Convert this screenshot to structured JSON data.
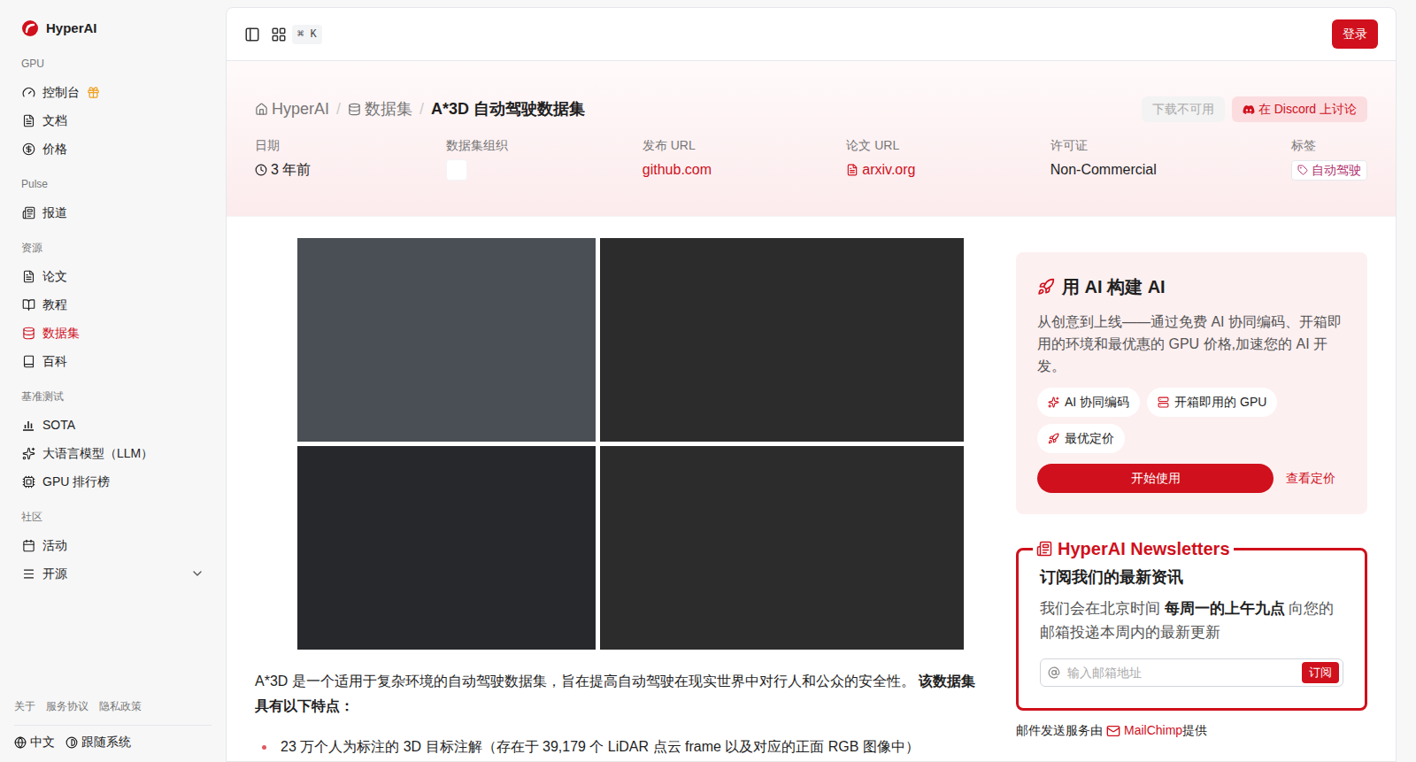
{
  "brand": "HyperAI",
  "sidebar": {
    "sections": [
      {
        "title": "GPU",
        "items": [
          {
            "label": "控制台",
            "selected": false,
            "kind": "link"
          },
          {
            "label": "文档",
            "selected": false,
            "kind": "link"
          },
          {
            "label": "价格",
            "selected": false,
            "kind": "link"
          }
        ]
      },
      {
        "title": "Pulse",
        "items": [
          {
            "label": "报道",
            "selected": false,
            "kind": "link"
          }
        ]
      },
      {
        "title": "资源",
        "items": [
          {
            "label": "论文",
            "selected": false,
            "kind": "link"
          },
          {
            "label": "教程",
            "selected": false,
            "kind": "link"
          },
          {
            "label": "数据集",
            "selected": true,
            "kind": "link"
          },
          {
            "label": "百科",
            "selected": false,
            "kind": "link"
          }
        ]
      },
      {
        "title": "基准测试",
        "items": [
          {
            "label": "SOTA",
            "selected": false,
            "kind": "link"
          },
          {
            "label": "大语言模型（LLM）",
            "selected": false,
            "kind": "link"
          },
          {
            "label": "GPU 排行榜",
            "selected": false,
            "kind": "link"
          }
        ]
      },
      {
        "title": "社区",
        "items": [
          {
            "label": "活动",
            "selected": false,
            "kind": "link"
          },
          {
            "label": "开源",
            "selected": false,
            "kind": "group",
            "expanded": false
          }
        ]
      }
    ],
    "footer_links": [
      "关于",
      "服务协议",
      "隐私政策"
    ],
    "language": "中文",
    "theme": "跟随系统"
  },
  "header": {
    "shortcut": "⌘ K",
    "login": "登录"
  },
  "breadcrumb": {
    "items": [
      "HyperAI",
      "数据集"
    ],
    "current": "A*3D 自动驾驶数据集",
    "separator": "/"
  },
  "actions": [
    {
      "label": "下载不可用",
      "disabled": true
    },
    {
      "label": "在 Discord 上讨论",
      "disabled": false
    }
  ],
  "meta": {
    "date": {
      "label": "日期",
      "value": "3 年前"
    },
    "org": {
      "label": "数据集组织"
    },
    "release": {
      "label": "发布 URL",
      "value": "github.com"
    },
    "paper": {
      "label": "论文 URL",
      "value": "arxiv.org"
    },
    "license": {
      "label": "许可证",
      "value": "Non-Commercial"
    },
    "tags": {
      "label": "标签",
      "value": "自动驾驶"
    }
  },
  "body": {
    "intro": "A*3D 是一个适用于复杂环境的自动驾驶数据集，旨在提高自动驾驶在现实世界中对行人和公众的安全性。 ",
    "intro_bold": "该数据集具有以下特点：",
    "bullets": [
      "23 万个人为标注的 3D 目标注解（存在于 39,179 个 LiDAR 点云 frame 以及对应的正面 RGB 图像中）"
    ]
  },
  "promo": {
    "title": "用 AI 构建 AI",
    "description": "从创意到上线——通过免费 AI 协同编码、开箱即用的环境和最优惠的 GPU 价格,加速您的 AI 开发。",
    "chips": [
      "AI 协同编码",
      "开箱即用的 GPU",
      "最优定价"
    ],
    "primary": "开始使用",
    "secondary": "查看定价"
  },
  "newsletter": {
    "title": "HyperAI Newsletters",
    "heading": "订阅我们的最新资讯",
    "desc_before": "我们会在北京时间 ",
    "desc_bold": "每周一的上午九点",
    "desc_after": " 向您的邮箱投递本周内的最新更新",
    "placeholder": "输入邮箱地址",
    "button": "订阅",
    "provider_before": "邮件发送服务由 ",
    "provider": "MailChimp",
    "provider_after": " 提供"
  }
}
